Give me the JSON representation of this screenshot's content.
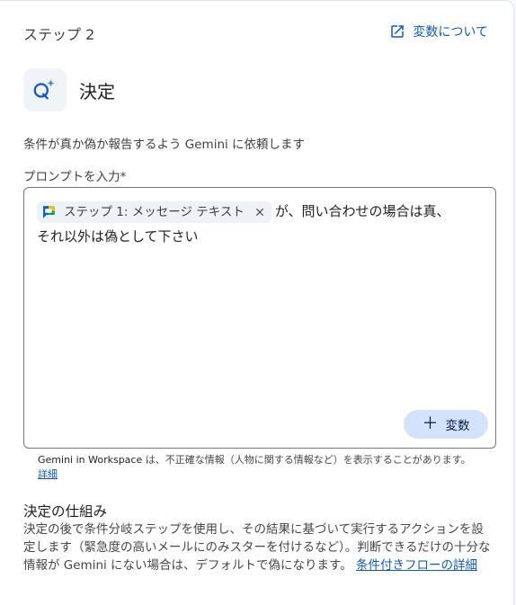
{
  "header": {
    "step_label": "ステップ 2",
    "variables_link": "変数について",
    "title": "決定"
  },
  "description": "条件が真か偽か報告するよう Gemini に依頼します",
  "prompt": {
    "label": "プロンプトを入力*",
    "chip_label": "ステップ 1: メッセージ テキスト",
    "text_after_chip": "が、問い合わせの場合は真、",
    "text_line2": "それ以外は偽として下さい",
    "add_variable_label": "変数"
  },
  "disclaimer": {
    "brand": "Gemini in Workspace",
    "text": " は、不正確な情報（人物に関する情報など）を表示することがあります。",
    "link": "詳細"
  },
  "how_it_works": {
    "title": "決定の仕組み",
    "body": "決定の後で条件分岐ステップを使用し、その結果に基づいて実行するアクションを設定します（緊急度の高いメールにのみスターを付けるなど）。判断できるだけの十分な情報が Gemini にない場合は、デフォルトで偽になります。",
    "link": "条件付きフローの詳細"
  },
  "icons": {
    "external": "open-in-new-icon",
    "decision": "gemini-decision-icon",
    "chat": "google-chat-icon",
    "close": "close-icon",
    "add": "plus-icon"
  },
  "colors": {
    "accent": "#0b57d0",
    "chip_bg": "#eef1f5",
    "button_bg": "#d3e3fd"
  }
}
